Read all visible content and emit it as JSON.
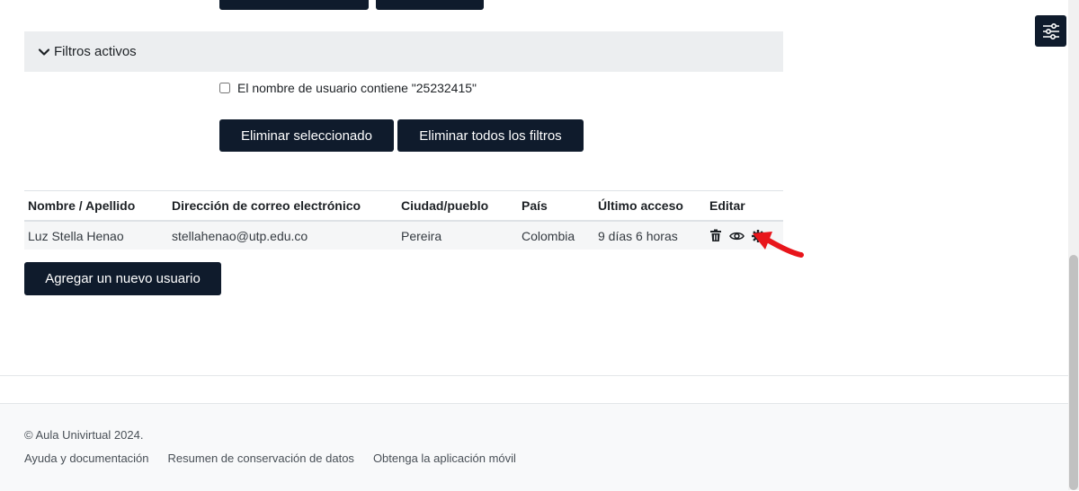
{
  "top_buttons": {
    "first": "",
    "second": ""
  },
  "filters": {
    "header": "Filtros activos",
    "items": [
      {
        "label": "El nombre de usuario contiene \"25232415\"",
        "checked": false
      }
    ],
    "remove_selected": "Eliminar seleccionado",
    "remove_all": "Eliminar todos los filtros"
  },
  "table": {
    "headers": [
      "Nombre / Apellido",
      "Dirección de correo electrónico",
      "Ciudad/pueblo",
      "País",
      "Último acceso",
      "Editar"
    ],
    "rows": [
      {
        "name": "Luz Stella Henao",
        "email": "stellahenao@utp.edu.co",
        "city": "Pereira",
        "country": "Colombia",
        "last_access": "9 días 6 horas",
        "actions": [
          "trash-icon",
          "eye-icon",
          "gear-icon"
        ]
      }
    ]
  },
  "add_user_button": "Agregar un nuevo usuario",
  "footer": {
    "copyright": "© Aula Univirtual 2024.",
    "links": [
      "Ayuda y documentación",
      "Resumen de conservación de datos",
      "Obtenga la aplicación móvil"
    ]
  },
  "colors": {
    "primary": "#0f1b2c",
    "annotation_arrow": "#e8151b",
    "filter_bg": "#eceef0",
    "row_bg": "#f5f6f7"
  },
  "icons": {
    "drawer_toggle": "sliders-icon",
    "filter_chevron": "chevron-down-icon"
  }
}
